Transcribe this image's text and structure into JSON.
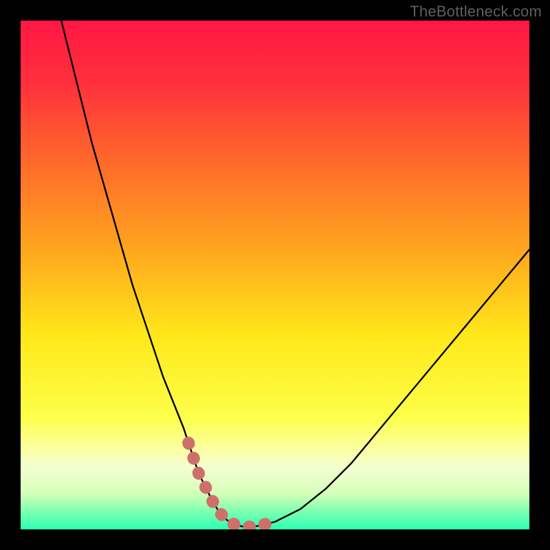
{
  "watermark": "TheBottleneck.com",
  "colors": {
    "background": "#000000",
    "watermark_text": "#5f5f5f",
    "curve_stroke": "#000000",
    "marker_stroke": "#cf6f6b",
    "gradient_stops": [
      {
        "offset": 0.0,
        "color": "#ff1744"
      },
      {
        "offset": 0.12,
        "color": "#ff2f3d"
      },
      {
        "offset": 0.28,
        "color": "#ff6a2a"
      },
      {
        "offset": 0.45,
        "color": "#ffa61f"
      },
      {
        "offset": 0.62,
        "color": "#ffe81a"
      },
      {
        "offset": 0.78,
        "color": "#fdff4a"
      },
      {
        "offset": 0.84,
        "color": "#fbffa0"
      },
      {
        "offset": 0.88,
        "color": "#f4ffd1"
      },
      {
        "offset": 0.93,
        "color": "#d4ffb8"
      },
      {
        "offset": 0.965,
        "color": "#7cffb0"
      },
      {
        "offset": 1.0,
        "color": "#2dffb3"
      }
    ]
  },
  "chart_data": {
    "type": "line",
    "title": "",
    "xlabel": "",
    "ylabel": "",
    "xlim": [
      0,
      100
    ],
    "ylim": [
      0,
      100
    ],
    "series": [
      {
        "name": "bottleneck-curve",
        "x": [
          8,
          10,
          12,
          14,
          16,
          18,
          20,
          22,
          24,
          26,
          28,
          30,
          32,
          33,
          34,
          35,
          36,
          37,
          38,
          39,
          40,
          41,
          42,
          43,
          44,
          45,
          47,
          50,
          55,
          60,
          65,
          70,
          75,
          80,
          85,
          90,
          95,
          100
        ],
        "y": [
          100,
          92,
          84,
          76,
          69,
          62,
          55,
          48,
          42,
          36,
          30,
          25,
          20,
          17,
          14,
          11,
          9,
          7,
          5,
          3.5,
          2.3,
          1.5,
          1.0,
          0.7,
          0.5,
          0.5,
          0.7,
          1.5,
          4,
          8,
          13,
          19,
          25,
          31,
          37,
          43,
          49,
          55
        ]
      }
    ],
    "markers": {
      "name": "highlighted-range",
      "x": [
        33,
        34,
        35,
        36,
        37,
        38,
        39,
        40,
        41,
        42,
        43,
        44,
        45,
        46,
        47,
        48,
        49,
        50
      ],
      "y": [
        17,
        14,
        11,
        9,
        7,
        5,
        3.5,
        2.3,
        1.5,
        1.0,
        0.7,
        0.5,
        0.5,
        0.6,
        0.7,
        1.0,
        1.2,
        1.5
      ]
    }
  }
}
